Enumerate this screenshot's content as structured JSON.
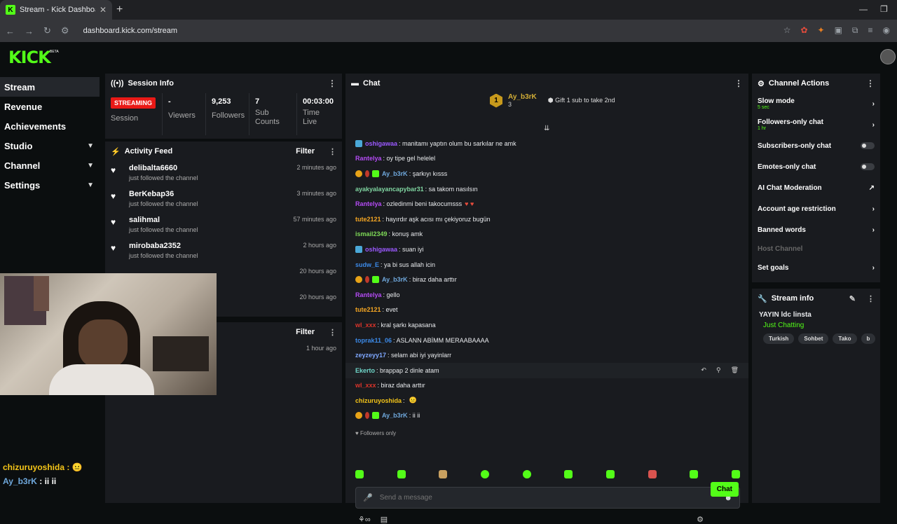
{
  "browser": {
    "tab_title": "Stream - Kick Dashboard",
    "url": "dashboard.kick.com/stream"
  },
  "app": {
    "logo": "KICK",
    "logo_beta": "BETA"
  },
  "sidebar": {
    "items": [
      {
        "label": "Stream",
        "active": true
      },
      {
        "label": "Revenue"
      },
      {
        "label": "Achievements"
      },
      {
        "label": "Studio",
        "expandable": true
      },
      {
        "label": "Channel",
        "expandable": true
      },
      {
        "label": "Settings",
        "expandable": true
      }
    ]
  },
  "session": {
    "title": "Session Info",
    "status": "STREAMING",
    "status_label": "Session",
    "viewers_val": "-",
    "viewers_lbl": "Viewers",
    "followers_val": "9,253",
    "followers_lbl": "Followers",
    "subs_val": "7",
    "subs_lbl": "Sub Counts",
    "time_val": "00:03:00",
    "time_lbl": "Time Live"
  },
  "activity": {
    "title": "Activity Feed",
    "filter": "Filter",
    "items": [
      {
        "name": "delibalta6660",
        "sub": "just followed the channel",
        "time": "2 minutes ago"
      },
      {
        "name": "BerKebap36",
        "sub": "just followed the channel",
        "time": "3 minutes ago"
      },
      {
        "name": "salihmal",
        "sub": "just followed the channel",
        "time": "57 minutes ago"
      },
      {
        "name": "mirobaba2352",
        "sub": "just followed the channel",
        "time": "2 hours ago"
      }
    ],
    "hidden_times": [
      "20 hours ago",
      "20 hours ago"
    ]
  },
  "second_panel": {
    "filter": "Filter",
    "time": "1 hour ago"
  },
  "overlay": {
    "line1_name": "chizuruyoshida",
    "line1_sep": " :",
    "line2_name": "Ay_b3rK",
    "line2_text": " : ii ii"
  },
  "chat": {
    "title": "Chat",
    "pinned_name": "Ay_b3rK",
    "pinned_badge": "1",
    "pinned_count": "3",
    "gift_text": "Gift 1 sub to take 2nd",
    "messages": [
      {
        "user": "oshigawaa",
        "color": "#9b59ff",
        "text": ": manitamı yaptın olum bu sarkılar ne amk"
      },
      {
        "user": "Rantelya",
        "color": "#b44bf5",
        "text": ": oy tipe gel helelel"
      },
      {
        "user": "Ay_b3rK",
        "color": "#6fa8dc",
        "text": ": şarkıyı kısss"
      },
      {
        "user": "ayakyalayancapybar31",
        "color": "#7fd4a0",
        "text": ": sa takom nasılsın"
      },
      {
        "user": "Rantelya",
        "color": "#b44bf5",
        "text": ": ozledinmi beni takocumsss"
      },
      {
        "user": "tute2121",
        "color": "#f5a623",
        "text": ": hayırdır aşk acısı mı çekiyoruz bugün"
      },
      {
        "user": "ismail2349",
        "color": "#7ed957",
        "text": ": konuş amk"
      },
      {
        "user": "oshigawaa",
        "color": "#9b59ff",
        "text": ": suan iyi"
      },
      {
        "user": "sudw_E",
        "color": "#3c8ae8",
        "text": ": ya bi sus allah icin"
      },
      {
        "user": "Ay_b3rK",
        "color": "#6fa8dc",
        "text": ": biraz daha arttır"
      },
      {
        "user": "Rantelya",
        "color": "#b44bf5",
        "text": ": gello"
      },
      {
        "user": "tute2121",
        "color": "#f5a623",
        "text": ": evet"
      },
      {
        "user": "wl_xxx",
        "color": "#d9342b",
        "text": ": kral şarkı kapasana"
      },
      {
        "user": "toprak11_06",
        "color": "#3c8ae8",
        "text": ": ASLANN ABİMM MERAABAAAA"
      },
      {
        "user": "zeyzeyy17",
        "color": "#7fa8ff",
        "text": ": selam abi iyi yayinlarr"
      },
      {
        "user": "Ekerto",
        "color": "#6fd6c9",
        "text": ": brappap 2 dinle atam"
      },
      {
        "user": "wl_xxx",
        "color": "#d9342b",
        "text": ": biraz daha arttır"
      },
      {
        "user": "chizuruyoshida",
        "color": "#f5c518",
        "text": ":"
      },
      {
        "user": "Ay_b3rK",
        "color": "#6fa8dc",
        "text": ": ii ii"
      }
    ],
    "followers_only": "Followers only",
    "input_placeholder": "Send a message",
    "send_label": "Chat"
  },
  "channel_actions": {
    "title": "Channel Actions",
    "slow_mode": "Slow mode",
    "slow_mode_sub": "5 sec",
    "followers_only": "Followers-only chat",
    "followers_only_sub": "1 hr",
    "subs_only": "Subscribers-only chat",
    "emotes_only": "Emotes-only chat",
    "ai_mod": "AI Chat Moderation",
    "age_restriction": "Account age restriction",
    "banned_words": "Banned words",
    "host_channel": "Host Channel",
    "set_goals": "Set goals"
  },
  "stream_info": {
    "title": "Stream info",
    "stream_title": "YAYIN ldc linsta",
    "category": "Just Chatting",
    "tags": [
      "Turkish",
      "Sohbet",
      "Tako",
      "b"
    ]
  },
  "colors": {
    "brand": "#53fc18",
    "live": "#e91916",
    "panel": "#191b1f"
  }
}
